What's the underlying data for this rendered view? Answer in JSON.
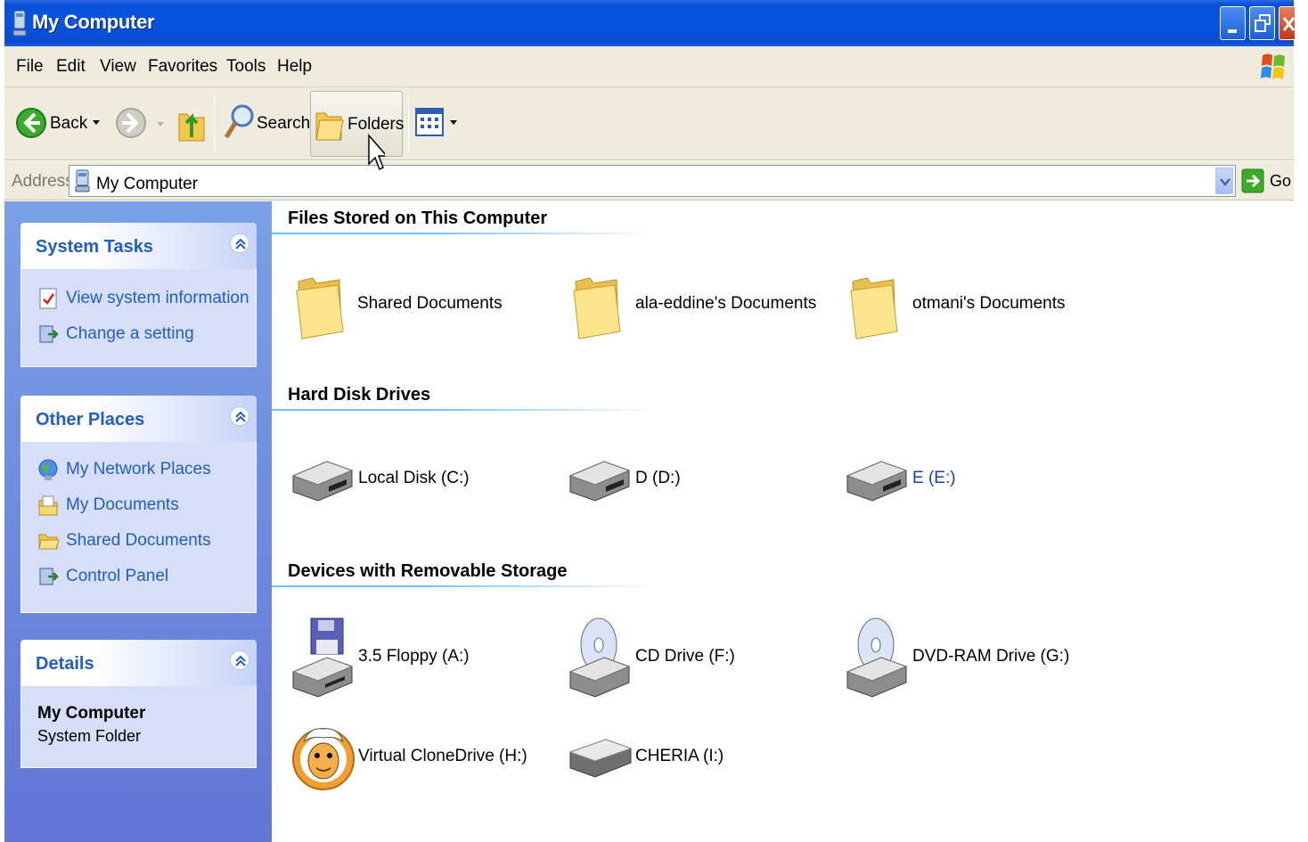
{
  "window": {
    "title": "My Computer"
  },
  "menu": {
    "items": [
      "File",
      "Edit",
      "View",
      "Favorites",
      "Tools",
      "Help"
    ]
  },
  "toolbar": {
    "back": "Back",
    "search": "Search",
    "folders": "Folders"
  },
  "address": {
    "label": "Address",
    "value": "My Computer",
    "go": "Go"
  },
  "sidebar": {
    "system_tasks": {
      "title": "System Tasks",
      "items": [
        {
          "label": "View system information",
          "icon": "system-info-icon"
        },
        {
          "label": "Change a setting",
          "icon": "control-panel-icon"
        }
      ]
    },
    "other_places": {
      "title": "Other Places",
      "items": [
        {
          "label": "My Network Places",
          "icon": "network-places-icon"
        },
        {
          "label": "My Documents",
          "icon": "my-documents-icon"
        },
        {
          "label": "Shared Documents",
          "icon": "folder-icon"
        },
        {
          "label": "Control Panel",
          "icon": "control-panel-icon"
        }
      ]
    },
    "details": {
      "title": "Details",
      "name": "My Computer",
      "type": "System Folder"
    }
  },
  "groups": {
    "files": {
      "title": "Files Stored on This Computer",
      "items": [
        "Shared Documents",
        "ala-eddine's Documents",
        "otmani's Documents"
      ]
    },
    "hard_disks": {
      "title": "Hard Disk Drives",
      "items": [
        "Local Disk (C:)",
        "D (D:)",
        "E (E:)"
      ]
    },
    "removable": {
      "title": "Devices with Removable Storage",
      "items": [
        "3.5 Floppy (A:)",
        "CD Drive (F:)",
        "DVD-RAM Drive (G:)",
        "Virtual CloneDrive (H:)",
        "CHERIA (I:)"
      ]
    }
  },
  "colors": {
    "titlebar": "#0554e3",
    "task_link": "#215dc6",
    "pane": "#7aa1e6"
  }
}
